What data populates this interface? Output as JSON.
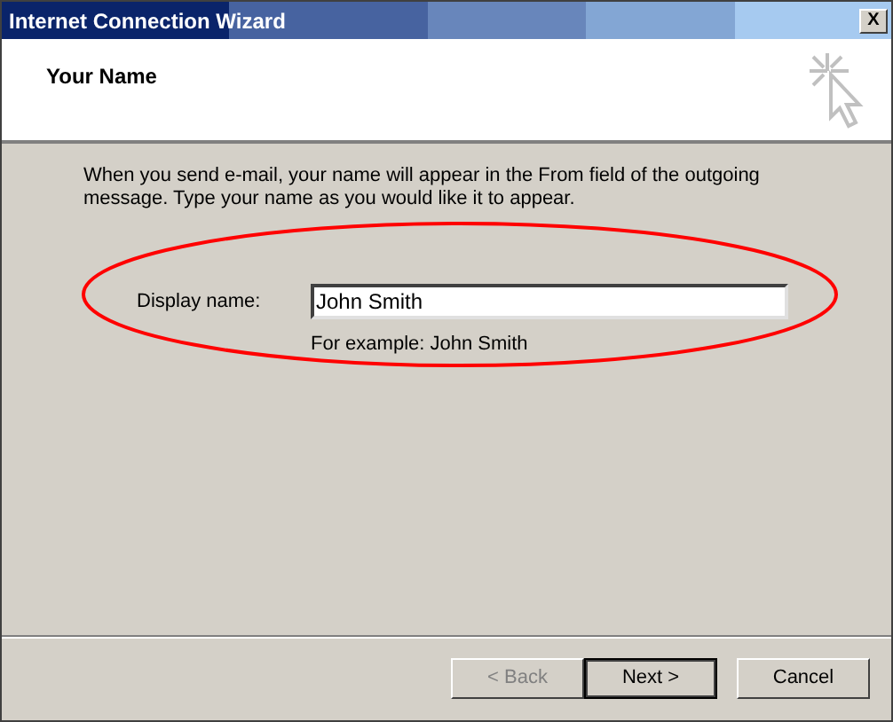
{
  "window": {
    "title": "Internet Connection Wizard",
    "close": "X"
  },
  "header": {
    "title": "Your Name"
  },
  "intro": "When you send e-mail, your name will appear in the From field of the outgoing message. Type your name as you would like it to appear.",
  "field": {
    "label": "Display name:",
    "value": "John Smith",
    "hint": "For example: John Smith",
    "highlighted": true
  },
  "buttons": [
    {
      "label": "< Back",
      "disabled": true,
      "default": false
    },
    {
      "label": "Next >",
      "disabled": false,
      "default": true
    },
    {
      "label": "Cancel",
      "disabled": false,
      "default": false
    }
  ]
}
